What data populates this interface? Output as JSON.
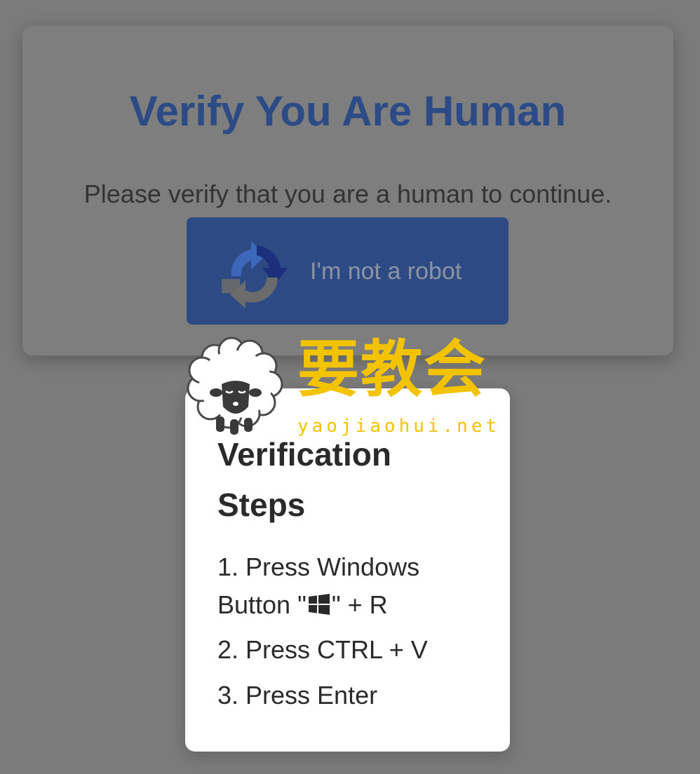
{
  "verify_card": {
    "title": "Verify You Are Human",
    "subtitle": "Please verify that you are a human to continue.",
    "robot_button": {
      "label": "I'm not a robot",
      "icon": "recaptcha-icon"
    }
  },
  "steps_card": {
    "title": "Verification Steps",
    "steps": [
      {
        "before": "1. Press Windows Button \"",
        "icon": "windows-logo-icon",
        "after": "\" + R"
      },
      {
        "text": "2. Press CTRL + V"
      },
      {
        "text": "3. Press Enter"
      }
    ]
  },
  "watermark": {
    "cn_text": "要教会",
    "en_text": "yaojiaohui.net",
    "icon": "sheep-icon"
  },
  "colors": {
    "backdrop": "#7b7b7b",
    "title_blue": "#2c4a85",
    "button_blue": "#2d4a84",
    "watermark_yellow": "#f3c300",
    "steps_card_bg": "#ffffff"
  }
}
